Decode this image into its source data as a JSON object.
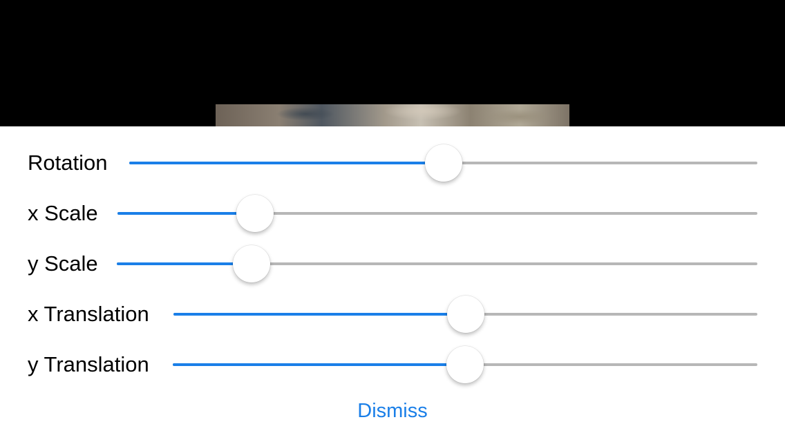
{
  "colors": {
    "accent": "#1a7fe8",
    "track": "#b7b7b7",
    "background_top": "#000000",
    "panel": "#ffffff"
  },
  "sliders": [
    {
      "label": "Rotation",
      "value": 0.5
    },
    {
      "label": "x Scale",
      "value": 0.215
    },
    {
      "label": "y Scale",
      "value": 0.21
    },
    {
      "label": "x Translation",
      "value": 0.5
    },
    {
      "label": "y Translation",
      "value": 0.5
    }
  ],
  "dismiss_label": "Dismiss"
}
